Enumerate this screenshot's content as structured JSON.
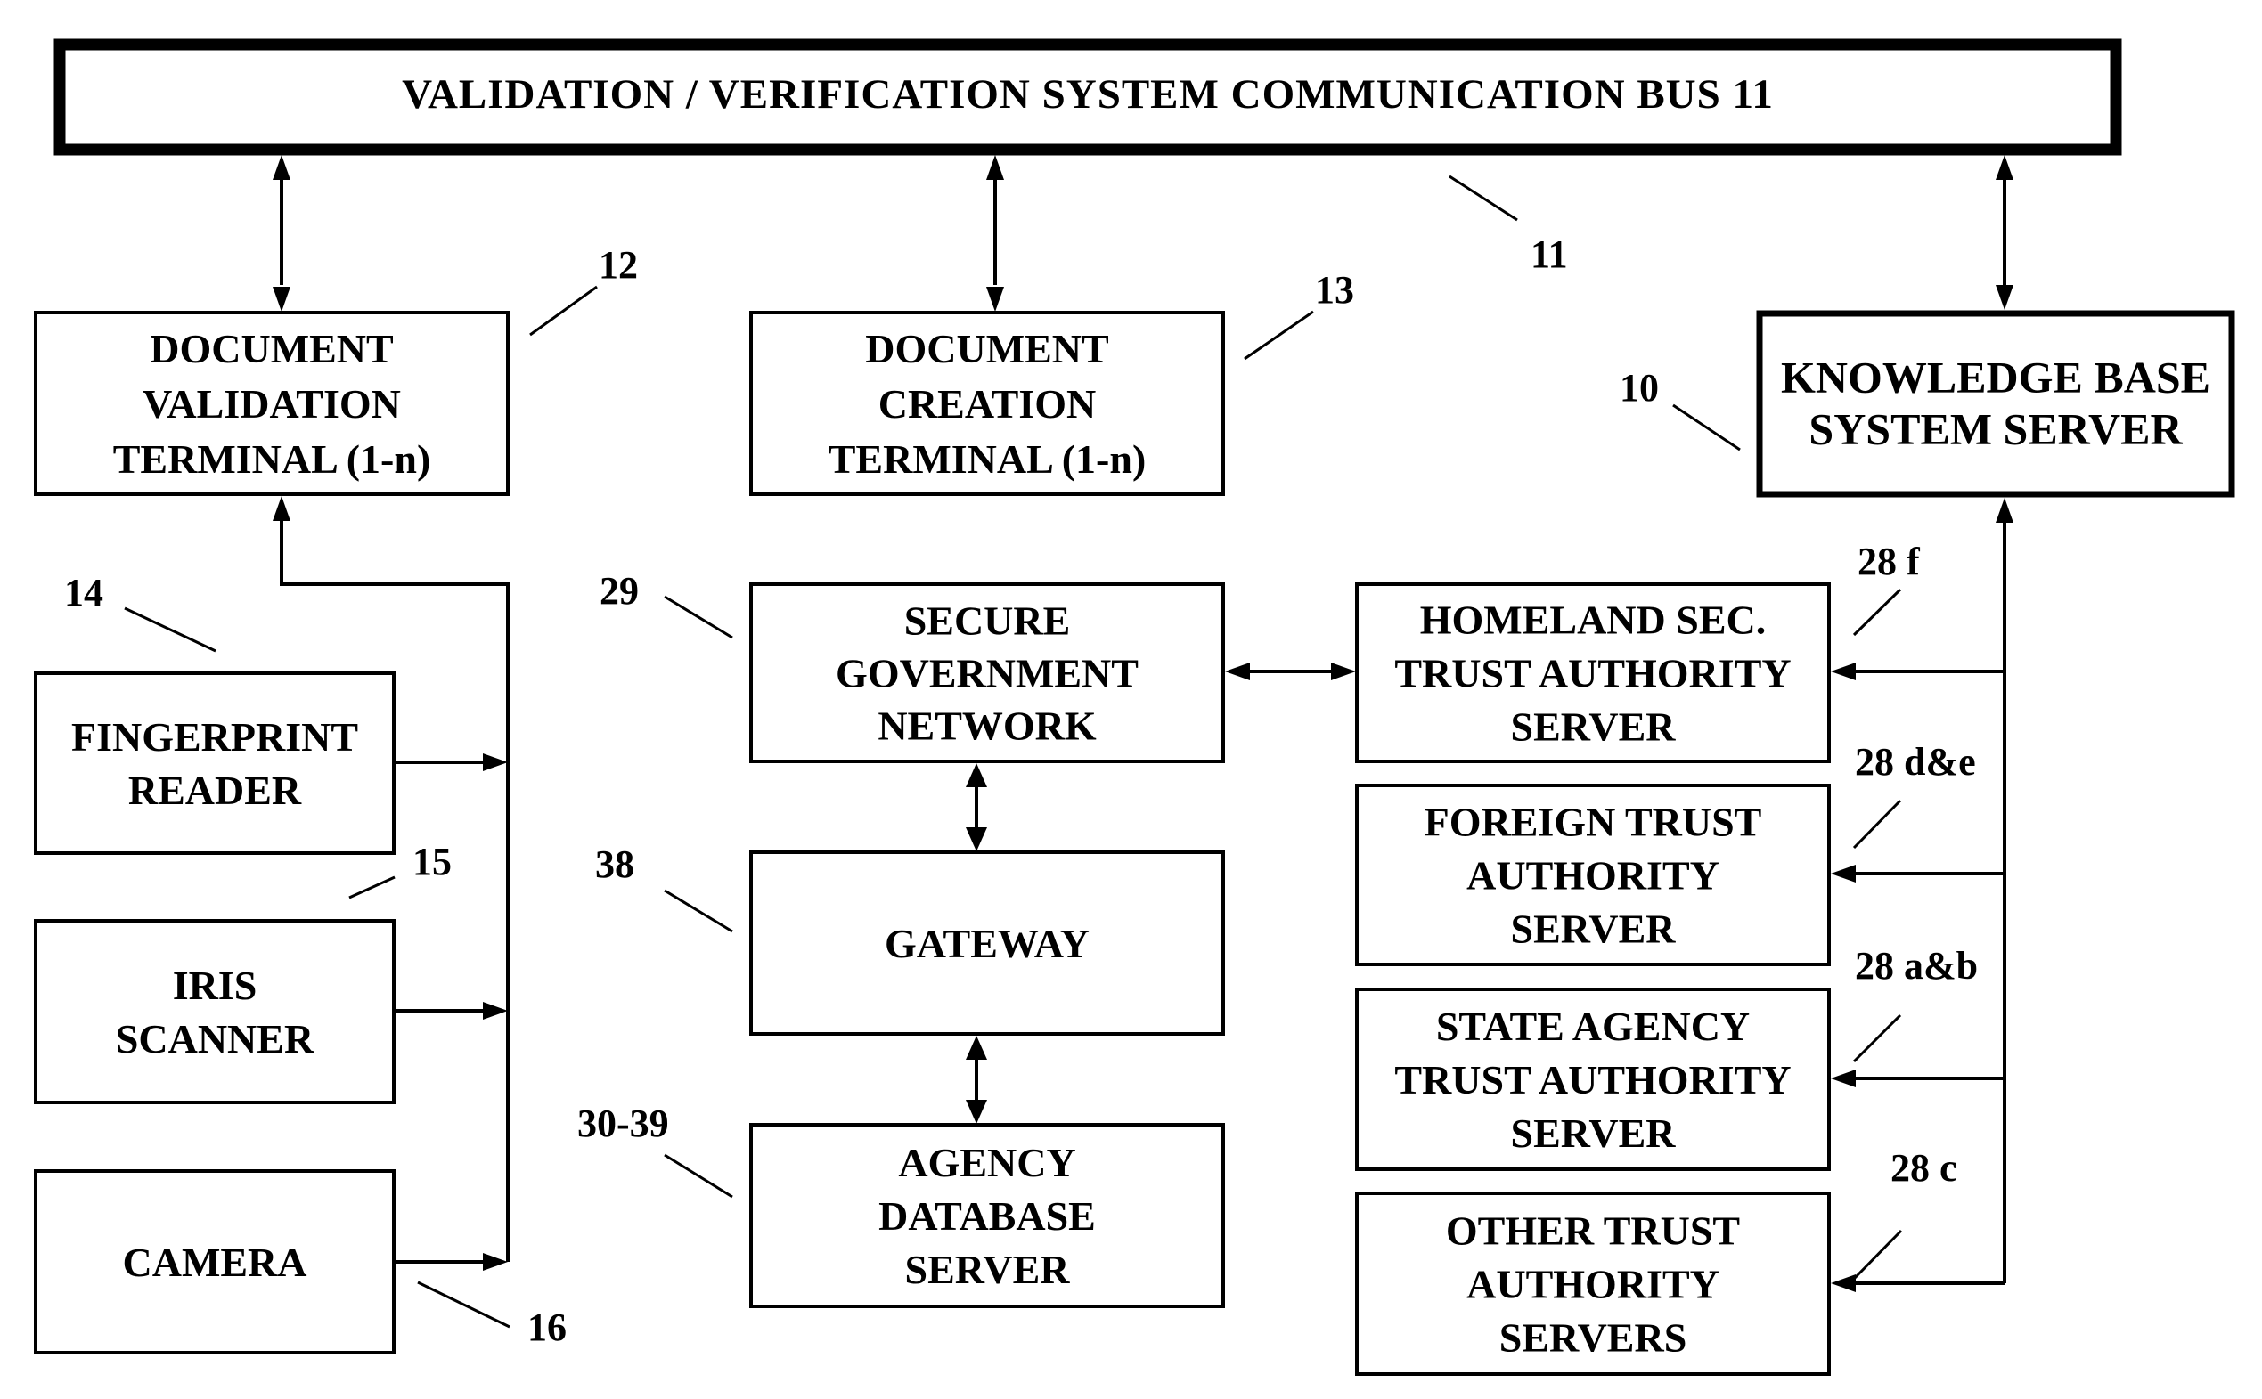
{
  "diagram": {
    "bus": {
      "label": "VALIDATION / VERIFICATION  SYSTEM  COMMUNICATION  BUS  11",
      "ref": "11"
    },
    "nodes": {
      "doc_validation_terminal": {
        "lines": [
          "DOCUMENT",
          "VALIDATION",
          "TERMINAL (1-n)"
        ],
        "ref": "12"
      },
      "doc_creation_terminal": {
        "lines": [
          "DOCUMENT",
          "CREATION",
          "TERMINAL (1-n)"
        ],
        "ref": "13"
      },
      "knowledge_base_server": {
        "lines": [
          "KNOWLEDGE BASE",
          "SYSTEM SERVER"
        ],
        "ref": "10"
      },
      "fingerprint_reader": {
        "lines": [
          "FINGERPRINT",
          "READER"
        ],
        "ref": "14"
      },
      "iris_scanner": {
        "lines": [
          "IRIS",
          "SCANNER"
        ],
        "ref": "15"
      },
      "camera": {
        "lines": [
          "CAMERA"
        ],
        "ref": "16"
      },
      "secure_government_network": {
        "lines": [
          "SECURE",
          "GOVERNMENT",
          "NETWORK"
        ],
        "ref": "29"
      },
      "gateway": {
        "lines": [
          "GATEWAY"
        ],
        "ref": "38"
      },
      "agency_database_server": {
        "lines": [
          "AGENCY",
          "DATABASE",
          "SERVER"
        ],
        "ref": "30-39"
      },
      "homeland_sec_server": {
        "lines": [
          "HOMELAND SEC.",
          "TRUST AUTHORITY",
          "SERVER"
        ],
        "ref": "28 f"
      },
      "foreign_trust_server": {
        "lines": [
          "FOREIGN TRUST",
          "AUTHORITY",
          "SERVER"
        ],
        "ref": "28 d&e"
      },
      "state_agency_server": {
        "lines": [
          "STATE AGENCY",
          "TRUST AUTHORITY",
          "SERVER"
        ],
        "ref": "28 a&b"
      },
      "other_trust_servers": {
        "lines": [
          "OTHER TRUST",
          "AUTHORITY",
          "SERVERS"
        ],
        "ref": "28 c"
      }
    },
    "connections": [
      {
        "from": "bus",
        "to": "doc_validation_terminal",
        "type": "bidirectional"
      },
      {
        "from": "bus",
        "to": "doc_creation_terminal",
        "type": "bidirectional"
      },
      {
        "from": "bus",
        "to": "knowledge_base_server",
        "type": "bidirectional"
      },
      {
        "from": "fingerprint_reader",
        "to": "doc_validation_terminal",
        "type": "directed"
      },
      {
        "from": "iris_scanner",
        "to": "doc_validation_terminal",
        "type": "directed"
      },
      {
        "from": "camera",
        "to": "doc_validation_terminal",
        "type": "directed"
      },
      {
        "from": "secure_government_network",
        "to": "homeland_sec_server",
        "type": "bidirectional"
      },
      {
        "from": "secure_government_network",
        "to": "gateway",
        "type": "bidirectional"
      },
      {
        "from": "gateway",
        "to": "agency_database_server",
        "type": "bidirectional"
      },
      {
        "from": "knowledge_base_server",
        "to": "homeland_sec_server",
        "type": "directed"
      },
      {
        "from": "knowledge_base_server",
        "to": "foreign_trust_server",
        "type": "directed"
      },
      {
        "from": "knowledge_base_server",
        "to": "state_agency_server",
        "type": "directed"
      },
      {
        "from": "knowledge_base_server",
        "to": "other_trust_servers",
        "type": "directed"
      }
    ]
  }
}
